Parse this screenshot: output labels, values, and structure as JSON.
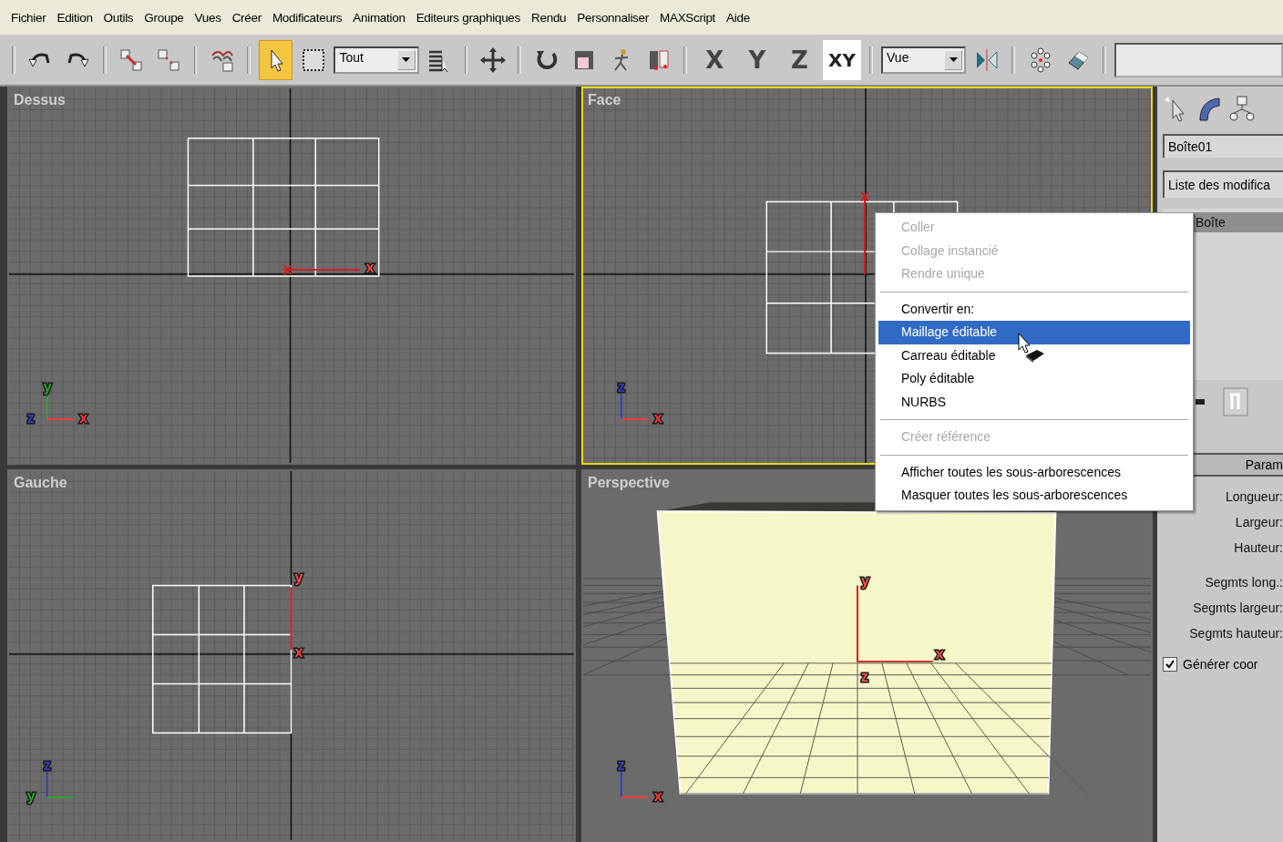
{
  "menu": [
    "Fichier",
    "Edition",
    "Outils",
    "Groupe",
    "Vues",
    "Créer",
    "Modificateurs",
    "Animation",
    "Editeurs graphiques",
    "Rendu",
    "Personnaliser",
    "MAXScript",
    "Aide"
  ],
  "toolbar": {
    "tools": [
      {
        "selected": false
      },
      {
        "selected": false
      },
      {
        "selected": false
      },
      {
        "selected": false
      },
      {
        "selected": false
      },
      {
        "selected": true
      },
      {
        "selected": false
      },
      {
        "selected": false
      },
      {
        "selected": false
      },
      {
        "selected": false
      },
      {
        "selected": false
      },
      {
        "selected": false
      },
      {
        "selected": false
      },
      {
        "selected": false
      },
      {
        "selected": false
      },
      {
        "selected": false
      }
    ],
    "selection_filter": "Tout",
    "coordinate_system": "Vue",
    "axis_buttons": [
      {
        "label": "X",
        "selected": false
      },
      {
        "label": "Y",
        "selected": false
      },
      {
        "label": "Z",
        "selected": false
      },
      {
        "label": "XY",
        "selected": true
      }
    ]
  },
  "viewports": [
    {
      "title": "Dessus",
      "kind": "top",
      "active": false,
      "gizmo": [
        {
          "kind": "up",
          "label": "y",
          "color": "#2aa52a"
        },
        {
          "kind": "corner",
          "label": "z",
          "color": "#3040c0"
        },
        {
          "kind": "right",
          "label": "x",
          "color": "#ff3b3b"
        }
      ],
      "pivot_labels": [
        "x"
      ]
    },
    {
      "title": "Face",
      "kind": "front",
      "active": true,
      "gizmo": [
        {
          "kind": "up",
          "label": "z",
          "color": "#3040c0"
        },
        {
          "kind": "right",
          "label": "x",
          "color": "#ff3b3b"
        }
      ]
    },
    {
      "title": "Gauche",
      "kind": "left",
      "active": false,
      "gizmo": [
        {
          "kind": "up",
          "label": "z",
          "color": "#3040c0"
        },
        {
          "kind": "corner",
          "label": "y",
          "color": "#2aa52a"
        }
      ],
      "pivot_labels": [
        "y",
        "x"
      ]
    },
    {
      "title": "Perspective",
      "kind": "perspective",
      "active": false,
      "gizmo": [
        {
          "kind": "up",
          "label": "z",
          "color": "#3040c0"
        },
        {
          "kind": "right",
          "label": "x",
          "color": "#ff3b3b"
        }
      ],
      "pivot_labels": [
        "y",
        "x",
        "z"
      ]
    }
  ],
  "context_menu": [
    {
      "kind": "item",
      "label": "Coller",
      "disabled": true,
      "selected": false
    },
    {
      "kind": "item",
      "label": "Collage instancié",
      "disabled": true,
      "selected": false
    },
    {
      "kind": "item",
      "label": "Rendre unique",
      "disabled": true,
      "selected": false
    },
    {
      "kind": "separator"
    },
    {
      "kind": "item",
      "label": "Convertir en:",
      "disabled": false,
      "selected": false
    },
    {
      "kind": "item",
      "label": "Maillage éditable",
      "disabled": false,
      "selected": true
    },
    {
      "kind": "item",
      "label": "Carreau éditable",
      "disabled": false,
      "selected": false
    },
    {
      "kind": "item",
      "label": "Poly éditable",
      "disabled": false,
      "selected": false
    },
    {
      "kind": "item",
      "label": "NURBS",
      "disabled": false,
      "selected": false
    },
    {
      "kind": "separator"
    },
    {
      "kind": "item",
      "label": "Créer référence",
      "disabled": true,
      "selected": false
    },
    {
      "kind": "separator"
    },
    {
      "kind": "item",
      "label": "Afficher toutes les sous-arborescences",
      "disabled": false,
      "selected": false
    },
    {
      "kind": "item",
      "label": "Masquer toutes les sous-arborescences",
      "disabled": false,
      "selected": false
    }
  ],
  "command_panel": {
    "object_name": "Boîte01",
    "modifier_list": "Liste des modifica",
    "stack": [
      {
        "label": "Boîte",
        "selected": true
      }
    ],
    "rollout": "Param",
    "parameters": [
      "Longueur:",
      "Largeur:",
      "Hauteur:",
      "Segmts long.:",
      "Segmts largeur:",
      "Segmts hauteur:"
    ],
    "checkbox": {
      "label": "Générer coor",
      "checked": true
    }
  }
}
